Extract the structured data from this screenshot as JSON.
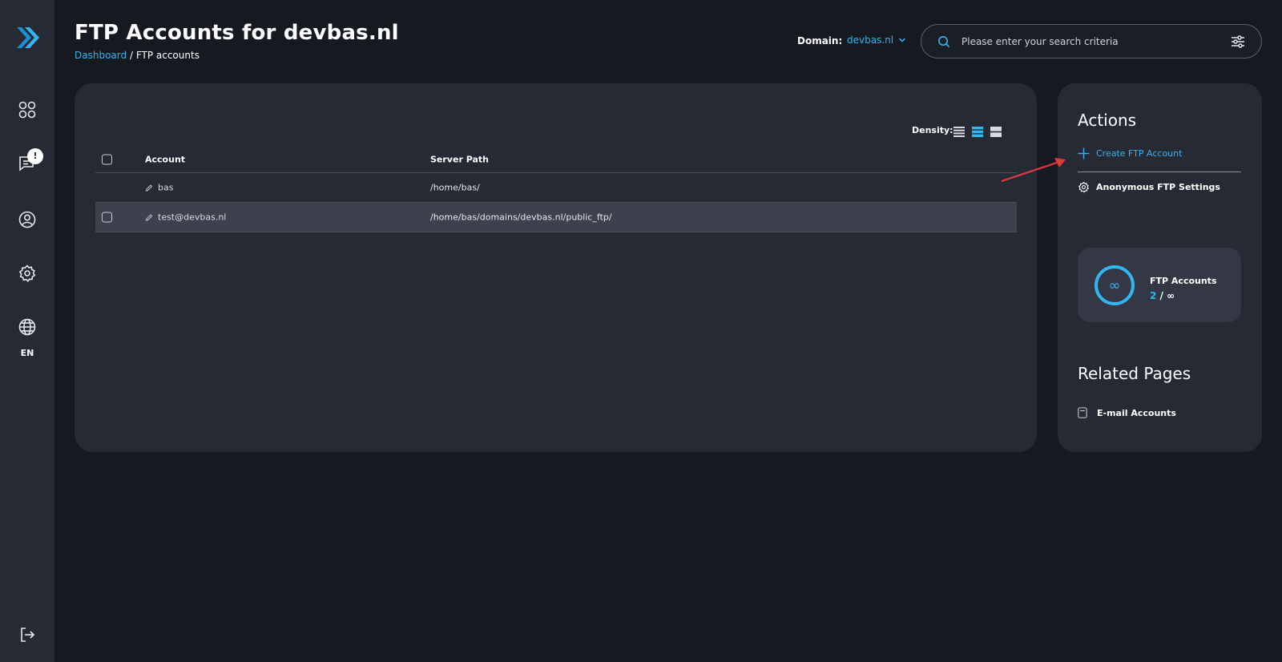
{
  "header": {
    "title": "FTP Accounts for devbas.nl",
    "breadcrumb": {
      "link": "Dashboard",
      "separator": "/",
      "current": "FTP accounts"
    },
    "domain_label": "Domain:",
    "domain_value": "devbas.nl",
    "search_placeholder": "Please enter your search criteria"
  },
  "sidebar": {
    "notification_badge": "!",
    "language": "EN"
  },
  "table": {
    "density_label": "Density:",
    "columns": {
      "account": "Account",
      "server_path": "Server Path"
    },
    "rows": [
      {
        "account": "bas",
        "path": "/home/bas/"
      },
      {
        "account": "test@devbas.nl",
        "path": "/home/bas/domains/devbas.nl/public_ftp/"
      }
    ]
  },
  "actions": {
    "title": "Actions",
    "create": "Create FTP Account",
    "anonymous": "Anonymous FTP Settings"
  },
  "stats": {
    "ring_symbol": "∞",
    "label": "FTP Accounts",
    "used": "2",
    "separator": "/",
    "limit": "∞"
  },
  "related": {
    "title": "Related Pages",
    "email": "E-mail Accounts"
  },
  "colors": {
    "accent": "#33b5f0",
    "background": "#151920",
    "card": "#262a34",
    "annotation_arrow": "#e03a3a"
  }
}
